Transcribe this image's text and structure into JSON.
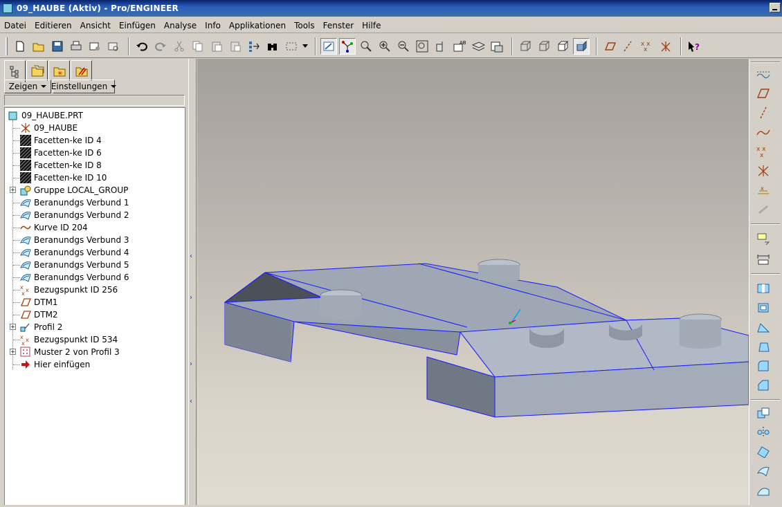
{
  "window": {
    "title": "09_HAUBE (Aktiv) - Pro/ENGINEER"
  },
  "menu": [
    {
      "label": "Datei"
    },
    {
      "label": "Editieren"
    },
    {
      "label": "Ansicht"
    },
    {
      "label": "Einfügen"
    },
    {
      "label": "Analyse"
    },
    {
      "label": "Info"
    },
    {
      "label": "Applikationen"
    },
    {
      "label": "Tools"
    },
    {
      "label": "Fenster"
    },
    {
      "label": "Hilfe"
    }
  ],
  "panel": {
    "show_label": "Zeigen",
    "settings_label": "Einstellungen"
  },
  "tree": {
    "root": "09_HAUBE.PRT",
    "items": [
      {
        "label": "09_HAUBE",
        "icon": "csys-icon",
        "expandable": false
      },
      {
        "label": "Facetten-ke ID 4",
        "icon": "facet-icon",
        "expandable": false
      },
      {
        "label": "Facetten-ke ID 6",
        "icon": "facet-icon",
        "expandable": false
      },
      {
        "label": "Facetten-ke ID 8",
        "icon": "facet-icon",
        "expandable": false
      },
      {
        "label": "Facetten-ke ID 10",
        "icon": "facet-icon",
        "expandable": false
      },
      {
        "label": "Gruppe LOCAL_GROUP",
        "icon": "group-icon",
        "expandable": true
      },
      {
        "label": "Beranundgs Verbund 1",
        "icon": "boundary-blend-icon",
        "expandable": false
      },
      {
        "label": "Beranundgs Verbund 2",
        "icon": "boundary-blend-icon",
        "expandable": false
      },
      {
        "label": "Kurve ID 204",
        "icon": "curve-icon",
        "expandable": false
      },
      {
        "label": "Beranundgs Verbund 3",
        "icon": "boundary-blend-icon",
        "expandable": false
      },
      {
        "label": "Beranundgs Verbund 4",
        "icon": "boundary-blend-icon",
        "expandable": false
      },
      {
        "label": "Beranundgs Verbund 5",
        "icon": "boundary-blend-icon",
        "expandable": false
      },
      {
        "label": "Beranundgs Verbund 6",
        "icon": "boundary-blend-icon",
        "expandable": false
      },
      {
        "label": "Bezugspunkt ID 256",
        "icon": "datum-point-icon",
        "expandable": false
      },
      {
        "label": "DTM1",
        "icon": "datum-plane-icon",
        "expandable": false
      },
      {
        "label": "DTM2",
        "icon": "datum-plane-icon",
        "expandable": false
      },
      {
        "label": "Profil 2",
        "icon": "profile-icon",
        "expandable": true
      },
      {
        "label": "Bezugspunkt ID 534",
        "icon": "datum-point-icon",
        "expandable": false
      },
      {
        "label": "Muster 2 von Profil 3",
        "icon": "pattern-icon",
        "expandable": true
      },
      {
        "label": "Hier einfügen",
        "icon": "insert-arrow-icon",
        "expandable": false
      }
    ]
  },
  "colors": {
    "titlebar": "#0a246a",
    "part_surface": "#9ea7b3",
    "edge_highlight": "#1a1aff"
  }
}
